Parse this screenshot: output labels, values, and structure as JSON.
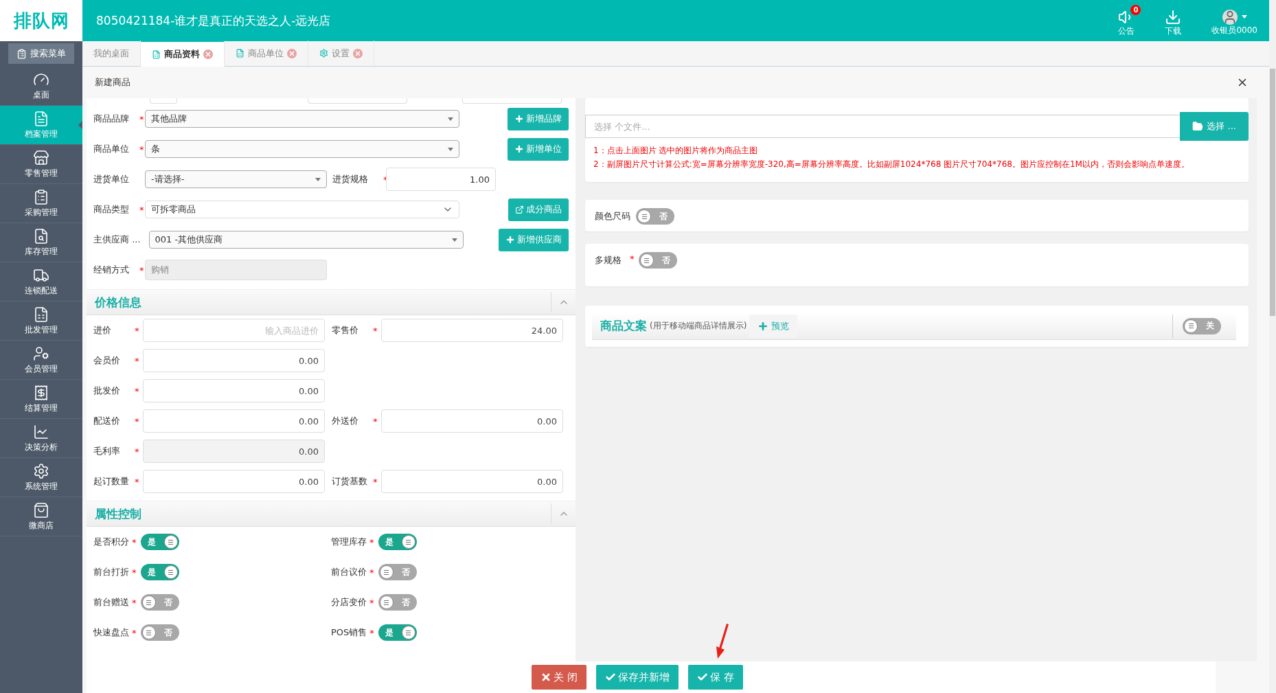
{
  "required_mark": "*",
  "logo": "排队网",
  "header": {
    "title": "8050421184-谁才是真正的天选之人-远光店",
    "actions": [
      {
        "kind": "notice",
        "label": "公告",
        "badge": "0"
      },
      {
        "kind": "download",
        "label": "下载"
      },
      {
        "kind": "user",
        "label": "收银员0000"
      }
    ]
  },
  "sidebar": {
    "search": "搜索菜单",
    "items": [
      {
        "label": "桌面",
        "selected": false
      },
      {
        "label": "档案管理",
        "selected": true
      },
      {
        "label": "零售管理",
        "selected": false
      },
      {
        "label": "采购管理",
        "selected": false
      },
      {
        "label": "库存管理",
        "selected": false
      },
      {
        "label": "连锁配送",
        "selected": false
      },
      {
        "label": "批发管理",
        "selected": false
      },
      {
        "label": "会员管理",
        "selected": false
      },
      {
        "label": "结算管理",
        "selected": false
      },
      {
        "label": "决策分析",
        "selected": false
      },
      {
        "label": "系统管理",
        "selected": false
      },
      {
        "label": "微商店",
        "selected": false
      }
    ]
  },
  "tabs": [
    {
      "label": "我的桌面",
      "selected": false,
      "closable": false,
      "kind": "plain"
    },
    {
      "label": "商品资料",
      "selected": true,
      "closable": true,
      "kind": "doc"
    },
    {
      "label": "商品单位",
      "selected": false,
      "closable": true,
      "kind": "doc"
    },
    {
      "label": "设置",
      "selected": false,
      "closable": true,
      "kind": "gear"
    }
  ],
  "dialog": {
    "title": "新建商品",
    "basic_rows": [
      {
        "cells": [
          {
            "label": "商品品牌",
            "required": true,
            "kind": "select",
            "value": "其他品牌"
          }
        ],
        "action": {
          "kind": "add",
          "label": "新增品牌"
        }
      },
      {
        "cells": [
          {
            "label": "商品单位",
            "required": true,
            "kind": "select",
            "value": "条"
          }
        ],
        "action": {
          "kind": "add",
          "label": "新增单位"
        }
      },
      {
        "cells": [
          {
            "label": "进货单位",
            "required": false,
            "kind": "select",
            "value": "-请选择-"
          },
          {
            "label": "进货规格",
            "required": true,
            "kind": "input",
            "value": "1.00"
          }
        ]
      },
      {
        "cells": [
          {
            "label": "商品类型",
            "required": true,
            "kind": "native-select",
            "value": "可拆零商品"
          }
        ],
        "action": {
          "kind": "link",
          "label": "成分商品"
        }
      },
      {
        "cells": [
          {
            "label": "主供应商 ...",
            "required": false,
            "kind": "select",
            "value": "001 -其他供应商"
          }
        ],
        "action": {
          "kind": "add",
          "label": "新增供应商"
        }
      },
      {
        "cells": [
          {
            "label": "经销方式",
            "required": true,
            "kind": "readonly",
            "value": "购销"
          }
        ]
      }
    ],
    "price_section": {
      "title": "价格信息",
      "expanded": true,
      "rows": [
        [
          {
            "label": "进价",
            "required": true,
            "placeholder": "输入商品进价",
            "disabled": false
          },
          {
            "label": "零售价",
            "required": true,
            "value": "24.00",
            "disabled": false
          }
        ],
        [
          {
            "label": "会员价",
            "required": true,
            "value": "0.00",
            "disabled": false
          }
        ],
        [
          {
            "label": "批发价",
            "required": true,
            "value": "0.00",
            "disabled": false
          }
        ],
        [
          {
            "label": "配送价",
            "required": true,
            "value": "0.00",
            "disabled": false
          },
          {
            "label": "外送价",
            "required": true,
            "value": "0.00",
            "disabled": false
          }
        ],
        [
          {
            "label": "毛利率",
            "required": true,
            "value": "0.00",
            "disabled": true
          }
        ],
        [
          {
            "label": "起订数量",
            "required": true,
            "value": "0.00",
            "disabled": false
          },
          {
            "label": "订货基数",
            "required": true,
            "value": "0.00",
            "disabled": false
          }
        ]
      ]
    },
    "attribute_section": {
      "title": "属性控制",
      "expanded": true,
      "rows": [
        [
          {
            "label": "是否积分",
            "required": true,
            "on": true,
            "text": "是"
          },
          {
            "label": "管理库存",
            "required": true,
            "on": true,
            "text": "是"
          }
        ],
        [
          {
            "label": "前台打折",
            "required": true,
            "on": true,
            "text": "是"
          },
          {
            "label": "前台议价",
            "required": true,
            "on": false,
            "text": "否"
          }
        ],
        [
          {
            "label": "前台赠送",
            "required": true,
            "on": false,
            "text": "否"
          },
          {
            "label": "分店变价",
            "required": true,
            "on": false,
            "text": "否"
          }
        ],
        [
          {
            "label": "快速盘点",
            "required": true,
            "on": false,
            "text": "否"
          },
          {
            "label": "POS销售",
            "required": true,
            "on": true,
            "text": "是"
          }
        ]
      ]
    },
    "image": {
      "placeholder": "选择 个文件...",
      "button": "选择 ...",
      "notes": [
        "1：点击上面图片 选中的图片将作为商品主图",
        "2：副屏图片尺寸计算公式:宽=屏幕分辨率宽度-320,高=屏幕分辨率高度。比如副屏1024*768 图片尺寸704*768。图片应控制在1M以内，否则会影响点单速度。"
      ]
    },
    "option_cards": [
      {
        "label": "颜色尺码",
        "required": false,
        "on": false,
        "text": "否"
      },
      {
        "label": "多规格",
        "required": true,
        "on": false,
        "text": "否"
      }
    ],
    "copy_panel": {
      "title": "商品文案",
      "subtitle": "(用于移动端商品详情展示)",
      "preview": "预览",
      "toggle": {
        "on": false,
        "text": "关"
      }
    },
    "footer_buttons": [
      {
        "kind": "danger",
        "label": "关 闭"
      },
      {
        "kind": "primary",
        "label": "保存并新增"
      },
      {
        "kind": "primary",
        "label": "保 存"
      }
    ]
  }
}
